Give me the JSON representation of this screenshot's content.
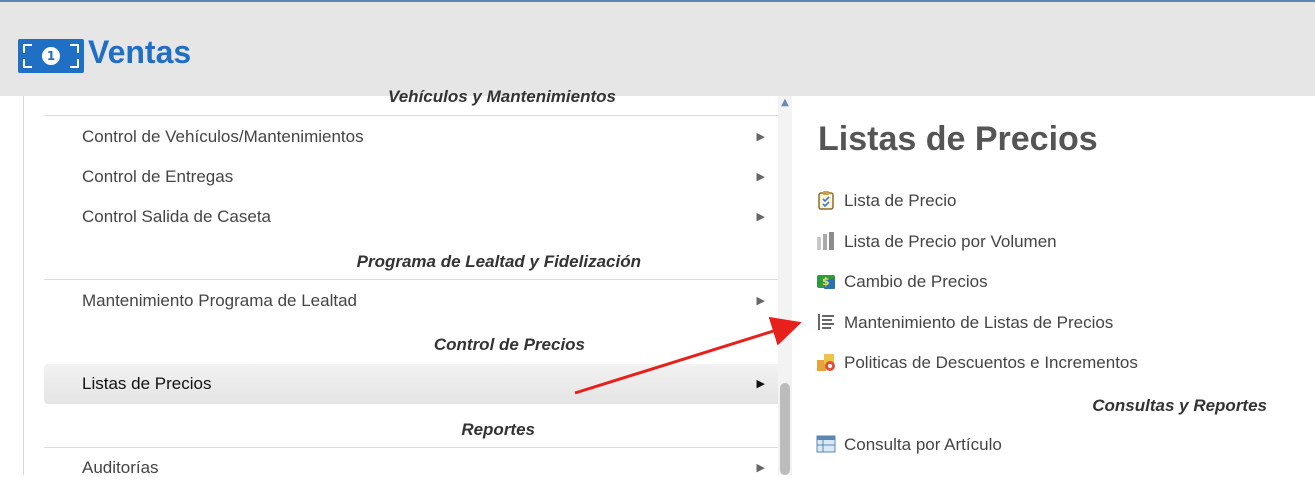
{
  "header": {
    "ghost_text": "",
    "app_title": "Ventas",
    "badge_number": "1"
  },
  "left_menu": {
    "top_partial_section": "Vehículos y Mantenimientos",
    "items_group1": [
      {
        "label": "Control de Vehículos/Mantenimientos"
      },
      {
        "label": "Control de Entregas"
      },
      {
        "label": "Control Salida de Caseta"
      }
    ],
    "section_lealtad": "Programa de Lealtad y Fidelización",
    "item_lealtad": "Mantenimiento Programa de Lealtad",
    "section_precios": "Control de Precios",
    "item_precios_active": "Listas de Precios",
    "section_reportes": "Reportes",
    "item_auditorias": "Auditorías",
    "arrow_glyph": "▶"
  },
  "right_panel": {
    "title": "Listas de Precios",
    "items": [
      {
        "label": "Lista de Precio",
        "icon": "clipboard-icon"
      },
      {
        "label": "Lista de Precio por Volumen",
        "icon": "bar-volume-icon"
      },
      {
        "label": "Cambio de Precios",
        "icon": "money-icon"
      },
      {
        "label": "Mantenimiento de Listas de Precios",
        "icon": "list-lines-icon"
      },
      {
        "label": "Politicas de Descuentos e Incrementos",
        "icon": "boxes-icon"
      }
    ],
    "section_consultas": "Consultas y Reportes",
    "consulta_item": {
      "label": "Consulta por Artículo",
      "icon": "table-icon"
    }
  },
  "colors": {
    "brand_blue": "#1f6fc5",
    "annotation_red": "#e8201c"
  }
}
